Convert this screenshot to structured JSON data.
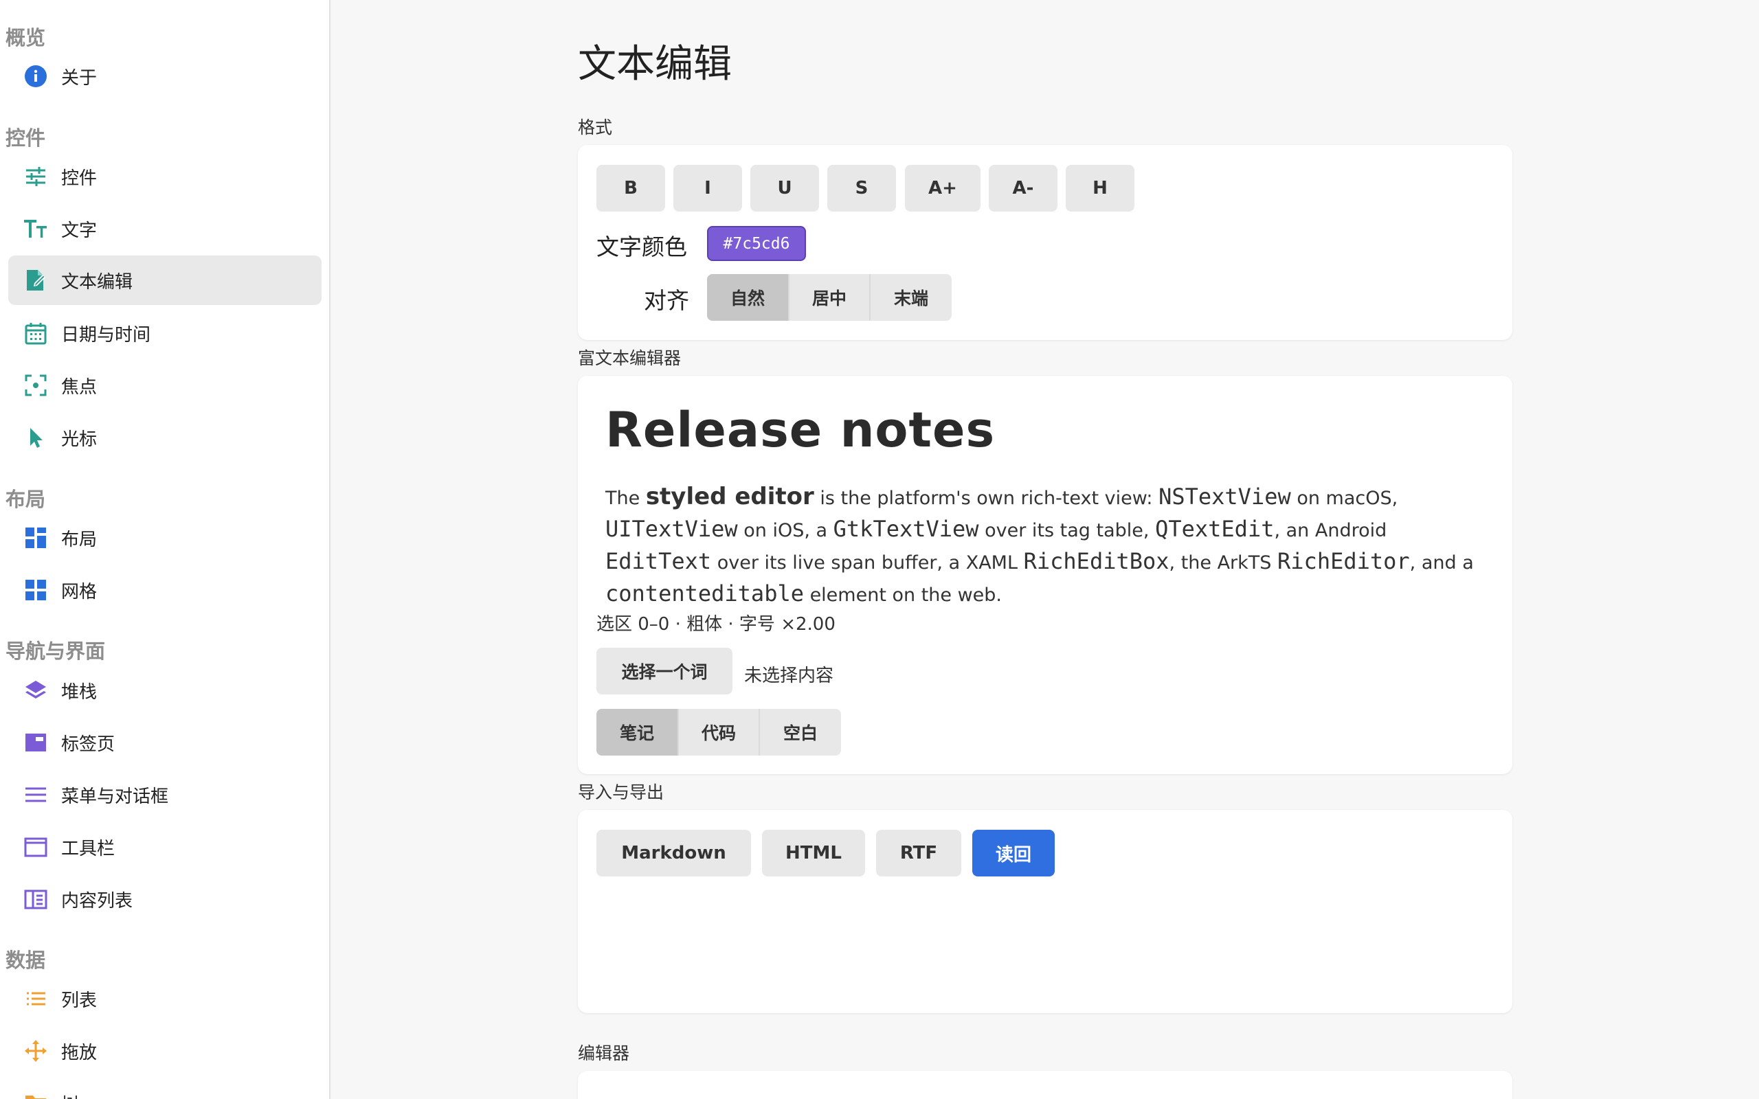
{
  "sidebar": {
    "sections": [
      {
        "title": "概览",
        "items": [
          {
            "label": "关于",
            "icon": "info-icon"
          }
        ]
      },
      {
        "title": "控件",
        "items": [
          {
            "label": "控件",
            "icon": "sliders-icon"
          },
          {
            "label": "文字",
            "icon": "text-size-icon"
          },
          {
            "label": "文本编辑",
            "icon": "edit-document-icon",
            "active": true
          },
          {
            "label": "日期与时间",
            "icon": "calendar-icon"
          },
          {
            "label": "焦点",
            "icon": "focus-icon"
          },
          {
            "label": "光标",
            "icon": "cursor-icon"
          }
        ]
      },
      {
        "title": "布局",
        "items": [
          {
            "label": "布局",
            "icon": "layout-icon"
          },
          {
            "label": "网格",
            "icon": "grid-icon"
          }
        ]
      },
      {
        "title": "导航与界面",
        "items": [
          {
            "label": "堆栈",
            "icon": "stack-icon"
          },
          {
            "label": "标签页",
            "icon": "tabs-icon"
          },
          {
            "label": "菜单与对话框",
            "icon": "menu-icon"
          },
          {
            "label": "工具栏",
            "icon": "toolbar-icon"
          },
          {
            "label": "内容列表",
            "icon": "content-list-icon"
          }
        ]
      },
      {
        "title": "数据",
        "items": [
          {
            "label": "列表",
            "icon": "list-icon"
          },
          {
            "label": "拖放",
            "icon": "drag-move-icon"
          },
          {
            "label": "树",
            "icon": "folder-icon"
          }
        ]
      }
    ]
  },
  "page": {
    "title": "文本编辑"
  },
  "format": {
    "label": "格式",
    "buttons": [
      "B",
      "I",
      "U",
      "S",
      "A+",
      "A-",
      "H"
    ],
    "text_color_label": "文字颜色",
    "text_color_value": "#7c5cd6",
    "align_label": "对齐",
    "align_options": [
      "自然",
      "居中",
      "末端"
    ],
    "align_selected": "自然"
  },
  "rich": {
    "label": "富文本编辑器",
    "heading": "Release notes",
    "body": {
      "p1": "The ",
      "b1": "styled editor",
      "p2": " is the platform's own rich-text view: ",
      "m1": "NSTextView",
      "p3": " on macOS, ",
      "m2": "UITextView",
      "p4": " on iOS, a ",
      "m3": "GtkTextView",
      "p5": " over its tag table, ",
      "m4": "QTextEdit",
      "p6": ", an Android ",
      "m5": "EditText",
      "p7": " over its live span buffer, a XAML ",
      "m6": "RichEditBox",
      "p8": ", the ArkTS ",
      "m7": "RichEditor",
      "p9": ", and a ",
      "m8": "contenteditable",
      "p10": " element on the web."
    },
    "status": "选区 0–0 · 粗体 · 字号 ×2.00",
    "select_word_button": "选择一个词",
    "selection_status": "未选择内容",
    "presets": [
      "笔记",
      "代码",
      "空白"
    ],
    "preset_selected": "笔记"
  },
  "io": {
    "label": "导入与导出",
    "buttons": [
      "Markdown",
      "HTML",
      "RTF"
    ],
    "readback_button": "读回"
  },
  "editor": {
    "label": "编辑器"
  },
  "colors": {
    "teal_icon": "#2a9d8f",
    "blue_icon": "#2a6fdb",
    "purple_icon": "#7b5bd6",
    "orange_icon": "#f0a030",
    "accent": "#2f6fe0"
  }
}
